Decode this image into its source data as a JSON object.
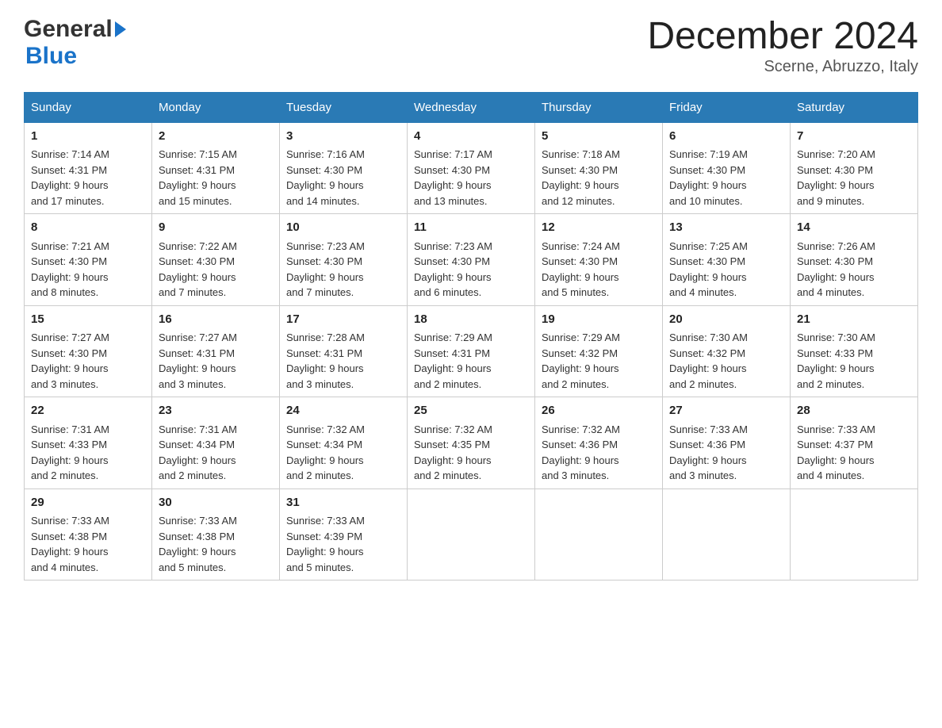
{
  "header": {
    "logo_text1": "General",
    "logo_text2": "Blue",
    "title": "December 2024",
    "subtitle": "Scerne, Abruzzo, Italy"
  },
  "days_of_week": [
    "Sunday",
    "Monday",
    "Tuesday",
    "Wednesday",
    "Thursday",
    "Friday",
    "Saturday"
  ],
  "weeks": [
    [
      {
        "day": "1",
        "sunrise": "7:14 AM",
        "sunset": "4:31 PM",
        "daylight": "9 hours and 17 minutes."
      },
      {
        "day": "2",
        "sunrise": "7:15 AM",
        "sunset": "4:31 PM",
        "daylight": "9 hours and 15 minutes."
      },
      {
        "day": "3",
        "sunrise": "7:16 AM",
        "sunset": "4:30 PM",
        "daylight": "9 hours and 14 minutes."
      },
      {
        "day": "4",
        "sunrise": "7:17 AM",
        "sunset": "4:30 PM",
        "daylight": "9 hours and 13 minutes."
      },
      {
        "day": "5",
        "sunrise": "7:18 AM",
        "sunset": "4:30 PM",
        "daylight": "9 hours and 12 minutes."
      },
      {
        "day": "6",
        "sunrise": "7:19 AM",
        "sunset": "4:30 PM",
        "daylight": "9 hours and 10 minutes."
      },
      {
        "day": "7",
        "sunrise": "7:20 AM",
        "sunset": "4:30 PM",
        "daylight": "9 hours and 9 minutes."
      }
    ],
    [
      {
        "day": "8",
        "sunrise": "7:21 AM",
        "sunset": "4:30 PM",
        "daylight": "9 hours and 8 minutes."
      },
      {
        "day": "9",
        "sunrise": "7:22 AM",
        "sunset": "4:30 PM",
        "daylight": "9 hours and 7 minutes."
      },
      {
        "day": "10",
        "sunrise": "7:23 AM",
        "sunset": "4:30 PM",
        "daylight": "9 hours and 7 minutes."
      },
      {
        "day": "11",
        "sunrise": "7:23 AM",
        "sunset": "4:30 PM",
        "daylight": "9 hours and 6 minutes."
      },
      {
        "day": "12",
        "sunrise": "7:24 AM",
        "sunset": "4:30 PM",
        "daylight": "9 hours and 5 minutes."
      },
      {
        "day": "13",
        "sunrise": "7:25 AM",
        "sunset": "4:30 PM",
        "daylight": "9 hours and 4 minutes."
      },
      {
        "day": "14",
        "sunrise": "7:26 AM",
        "sunset": "4:30 PM",
        "daylight": "9 hours and 4 minutes."
      }
    ],
    [
      {
        "day": "15",
        "sunrise": "7:27 AM",
        "sunset": "4:30 PM",
        "daylight": "9 hours and 3 minutes."
      },
      {
        "day": "16",
        "sunrise": "7:27 AM",
        "sunset": "4:31 PM",
        "daylight": "9 hours and 3 minutes."
      },
      {
        "day": "17",
        "sunrise": "7:28 AM",
        "sunset": "4:31 PM",
        "daylight": "9 hours and 3 minutes."
      },
      {
        "day": "18",
        "sunrise": "7:29 AM",
        "sunset": "4:31 PM",
        "daylight": "9 hours and 2 minutes."
      },
      {
        "day": "19",
        "sunrise": "7:29 AM",
        "sunset": "4:32 PM",
        "daylight": "9 hours and 2 minutes."
      },
      {
        "day": "20",
        "sunrise": "7:30 AM",
        "sunset": "4:32 PM",
        "daylight": "9 hours and 2 minutes."
      },
      {
        "day": "21",
        "sunrise": "7:30 AM",
        "sunset": "4:33 PM",
        "daylight": "9 hours and 2 minutes."
      }
    ],
    [
      {
        "day": "22",
        "sunrise": "7:31 AM",
        "sunset": "4:33 PM",
        "daylight": "9 hours and 2 minutes."
      },
      {
        "day": "23",
        "sunrise": "7:31 AM",
        "sunset": "4:34 PM",
        "daylight": "9 hours and 2 minutes."
      },
      {
        "day": "24",
        "sunrise": "7:32 AM",
        "sunset": "4:34 PM",
        "daylight": "9 hours and 2 minutes."
      },
      {
        "day": "25",
        "sunrise": "7:32 AM",
        "sunset": "4:35 PM",
        "daylight": "9 hours and 2 minutes."
      },
      {
        "day": "26",
        "sunrise": "7:32 AM",
        "sunset": "4:36 PM",
        "daylight": "9 hours and 3 minutes."
      },
      {
        "day": "27",
        "sunrise": "7:33 AM",
        "sunset": "4:36 PM",
        "daylight": "9 hours and 3 minutes."
      },
      {
        "day": "28",
        "sunrise": "7:33 AM",
        "sunset": "4:37 PM",
        "daylight": "9 hours and 4 minutes."
      }
    ],
    [
      {
        "day": "29",
        "sunrise": "7:33 AM",
        "sunset": "4:38 PM",
        "daylight": "9 hours and 4 minutes."
      },
      {
        "day": "30",
        "sunrise": "7:33 AM",
        "sunset": "4:38 PM",
        "daylight": "9 hours and 5 minutes."
      },
      {
        "day": "31",
        "sunrise": "7:33 AM",
        "sunset": "4:39 PM",
        "daylight": "9 hours and 5 minutes."
      },
      null,
      null,
      null,
      null
    ]
  ],
  "labels": {
    "sunrise": "Sunrise:",
    "sunset": "Sunset:",
    "daylight": "Daylight:"
  }
}
